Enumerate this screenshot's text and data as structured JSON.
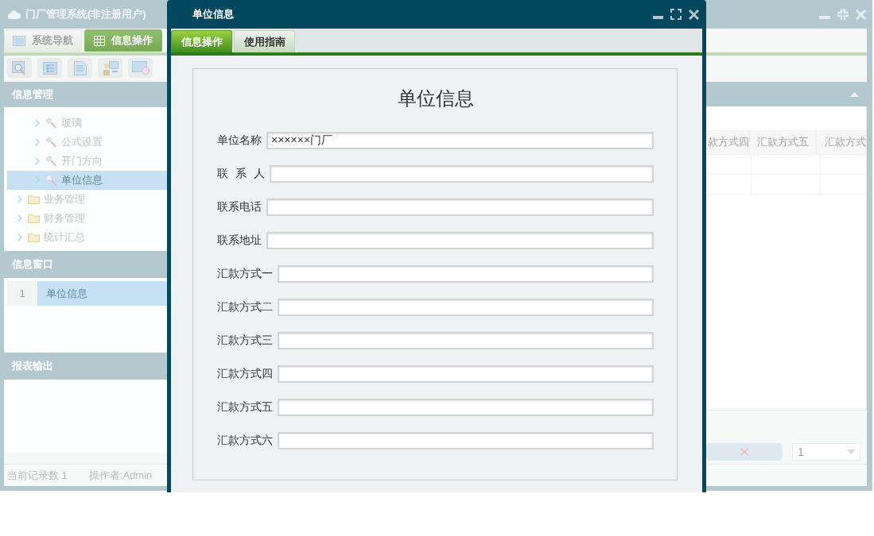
{
  "app": {
    "title": "门厂管理系统(非注册用户)",
    "tabs": [
      {
        "label": "系统导航",
        "selected": false
      },
      {
        "label": "信息操作",
        "selected": true
      }
    ]
  },
  "sidebar": {
    "info_management": {
      "title": "信息管理",
      "tree": [
        {
          "children": [
            {
              "label": "玻璃",
              "kind": "page",
              "selected": false
            },
            {
              "label": "公式设置",
              "kind": "page",
              "selected": false
            },
            {
              "label": "开门方向",
              "kind": "page",
              "selected": false
            },
            {
              "label": "单位信息",
              "kind": "page",
              "selected": true
            }
          ]
        },
        {
          "label": "业务管理",
          "kind": "folder",
          "selected": false
        },
        {
          "label": "财务管理",
          "kind": "folder",
          "selected": false
        },
        {
          "label": "统计汇总",
          "kind": "folder",
          "selected": false
        }
      ]
    },
    "info_window": {
      "title": "信息窗口",
      "rows": [
        {
          "number": "1",
          "label": "单位信息",
          "selected": true
        }
      ]
    },
    "report_output": {
      "title": "报表输出"
    }
  },
  "table": {
    "columns": [
      "款方式四",
      "汇款方式五",
      "汇款方式"
    ]
  },
  "pager": {
    "page": "1"
  },
  "status_bar": {
    "record_count": "当前记录数 1",
    "operator": "操作者:Admin"
  },
  "dialog": {
    "title": "单位信息",
    "tabs": [
      {
        "label": "信息操作",
        "selected": true
      },
      {
        "label": "使用指南",
        "selected": false
      }
    ],
    "form": {
      "heading": "单位信息",
      "fields": [
        {
          "label": "单位名称",
          "value": "××××××门厂"
        },
        {
          "label": "联 系 人"
        },
        {
          "label": "联系电话"
        },
        {
          "label": "联系地址"
        },
        {
          "label": "汇款方式一"
        },
        {
          "label": "汇款方式二"
        },
        {
          "label": "汇款方式三"
        },
        {
          "label": "汇款方式四"
        },
        {
          "label": "汇款方式五"
        },
        {
          "label": "汇款方式六"
        }
      ]
    }
  }
}
